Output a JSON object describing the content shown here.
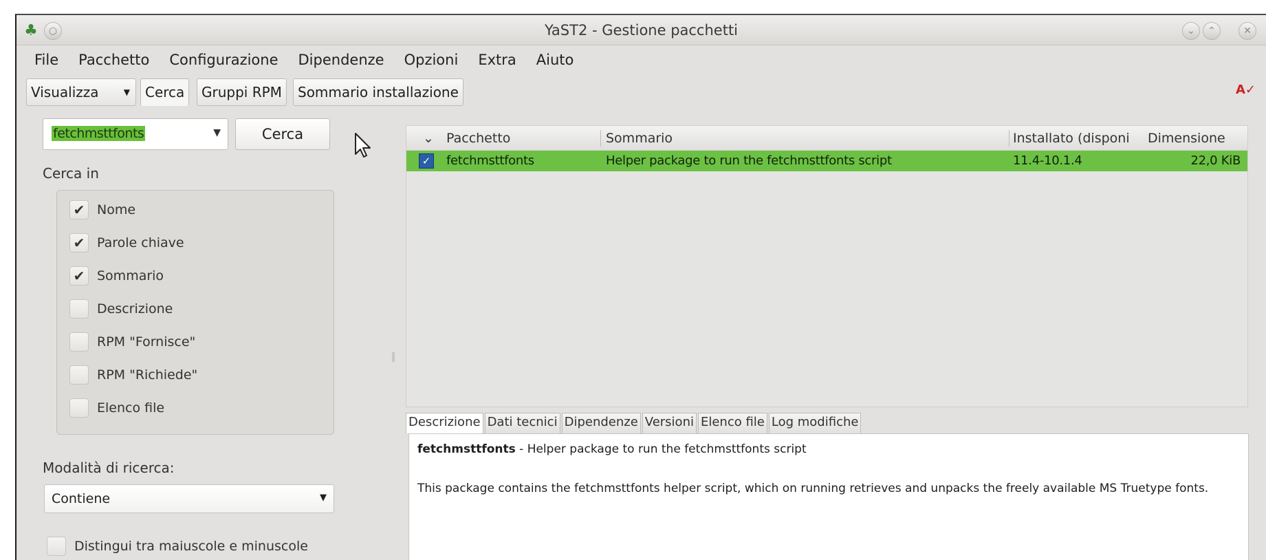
{
  "window": {
    "title": "YaST2 - Gestione pacchetti",
    "icons": [
      "yast-icon",
      "menu-circle-icon",
      "minimize-icon",
      "maximize-icon",
      "close-icon"
    ]
  },
  "menubar": [
    "File",
    "Pacchetto",
    "Configurazione",
    "Dipendenze",
    "Opzioni",
    "Extra",
    "Aiuto"
  ],
  "toolbar": {
    "view_label": "Visualizza",
    "tabs": [
      "Cerca",
      "Gruppi RPM",
      "Sommario installazione"
    ]
  },
  "search": {
    "value": "fetchmsttfonts",
    "button_label": "Cerca",
    "search_in_label": "Cerca in",
    "options": [
      {
        "label": "Nome",
        "checked": true
      },
      {
        "label": "Parole chiave",
        "checked": true
      },
      {
        "label": "Sommario",
        "checked": true
      },
      {
        "label": "Descrizione",
        "checked": false
      },
      {
        "label": "RPM \"Fornisce\"",
        "checked": false
      },
      {
        "label": "RPM \"Richiede\"",
        "checked": false
      },
      {
        "label": "Elenco file",
        "checked": false
      }
    ],
    "mode_label": "Modalità di ricerca:",
    "mode_value": "Contiene",
    "case_label": "Distingui tra maiuscole e minuscole",
    "case_checked": false
  },
  "packages": {
    "columns": [
      "Pacchetto",
      "Sommario",
      "Installato (disponi",
      "Dimensione"
    ],
    "rows": [
      {
        "name": "fetchmsttfonts",
        "summary": "Helper package to run the fetchmsttfonts script",
        "version": "11.4-10.1.4",
        "size": "22,0 KiB",
        "status_color": "#6cc144"
      }
    ]
  },
  "details": {
    "tabs": [
      "Descrizione",
      "Dati tecnici",
      "Dipendenze",
      "Versioni",
      "Elenco file",
      "Log modifiche"
    ],
    "name": "fetchmsttfonts",
    "summary_suffix": " - Helper package to run the fetchmsttfonts script",
    "body": "This package contains the fetchmsttfonts helper script, which on running retrieves and unpacks the freely available MS Truetype fonts."
  }
}
